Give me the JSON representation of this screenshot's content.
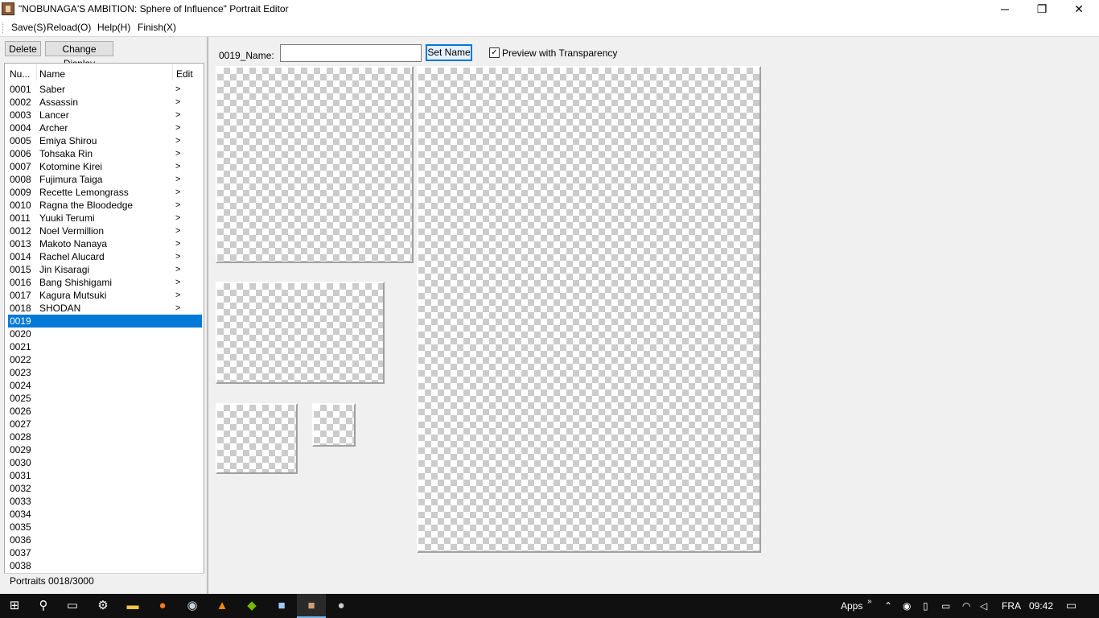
{
  "window": {
    "title": "\"NOBUNAGA'S AMBITION: Sphere of Influence\" Portrait Editor",
    "minimize": "─",
    "maximize": "❐",
    "close": "✕"
  },
  "menu": [
    {
      "label": "Save(S)"
    },
    {
      "label": "Reload(O)"
    },
    {
      "label": "Help(H)"
    },
    {
      "label": "Finish(X)"
    }
  ],
  "toolbar": {
    "delete_label": "Delete",
    "change_display_label": "Change Display"
  },
  "list": {
    "headers": {
      "num": "Nu...",
      "name": "Name",
      "edit": "Edit"
    },
    "rows": [
      {
        "num": "0001",
        "name": "Saber",
        "edit": ">"
      },
      {
        "num": "0002",
        "name": "Assassin",
        "edit": ">"
      },
      {
        "num": "0003",
        "name": "Lancer",
        "edit": ">"
      },
      {
        "num": "0004",
        "name": "Archer",
        "edit": ">"
      },
      {
        "num": "0005",
        "name": "Emiya Shirou",
        "edit": ">"
      },
      {
        "num": "0006",
        "name": "Tohsaka Rin",
        "edit": ">"
      },
      {
        "num": "0007",
        "name": "Kotomine Kirei",
        "edit": ">"
      },
      {
        "num": "0008",
        "name": "Fujimura Taiga",
        "edit": ">"
      },
      {
        "num": "0009",
        "name": "Recette Lemongrass",
        "edit": ">"
      },
      {
        "num": "0010",
        "name": "Ragna the Bloodedge",
        "edit": ">"
      },
      {
        "num": "0011",
        "name": "Yuuki Terumi",
        "edit": ">"
      },
      {
        "num": "0012",
        "name": "Noel Vermillion",
        "edit": ">"
      },
      {
        "num": "0013",
        "name": "Makoto Nanaya",
        "edit": ">"
      },
      {
        "num": "0014",
        "name": "Rachel Alucard",
        "edit": ">"
      },
      {
        "num": "0015",
        "name": "Jin Kisaragi",
        "edit": ">"
      },
      {
        "num": "0016",
        "name": "Bang Shishigami",
        "edit": ">"
      },
      {
        "num": "0017",
        "name": "Kagura Mutsuki",
        "edit": ">"
      },
      {
        "num": "0018",
        "name": "SHODAN",
        "edit": ">"
      },
      {
        "num": "0019",
        "name": "",
        "edit": "",
        "selected": true
      },
      {
        "num": "0020",
        "name": "",
        "edit": ""
      },
      {
        "num": "0021",
        "name": "",
        "edit": ""
      },
      {
        "num": "0022",
        "name": "",
        "edit": ""
      },
      {
        "num": "0023",
        "name": "",
        "edit": ""
      },
      {
        "num": "0024",
        "name": "",
        "edit": ""
      },
      {
        "num": "0025",
        "name": "",
        "edit": ""
      },
      {
        "num": "0026",
        "name": "",
        "edit": ""
      },
      {
        "num": "0027",
        "name": "",
        "edit": ""
      },
      {
        "num": "0028",
        "name": "",
        "edit": ""
      },
      {
        "num": "0029",
        "name": "",
        "edit": ""
      },
      {
        "num": "0030",
        "name": "",
        "edit": ""
      },
      {
        "num": "0031",
        "name": "",
        "edit": ""
      },
      {
        "num": "0032",
        "name": "",
        "edit": ""
      },
      {
        "num": "0033",
        "name": "",
        "edit": ""
      },
      {
        "num": "0034",
        "name": "",
        "edit": ""
      },
      {
        "num": "0035",
        "name": "",
        "edit": ""
      },
      {
        "num": "0036",
        "name": "",
        "edit": ""
      },
      {
        "num": "0037",
        "name": "",
        "edit": ""
      },
      {
        "num": "0038",
        "name": "",
        "edit": ""
      }
    ]
  },
  "status": {
    "text": "Portraits 0018/3000"
  },
  "editor": {
    "name_label": "0019_Name:",
    "name_value": "",
    "set_name_label": "Set Name",
    "preview_label": "Preview with Transparency",
    "preview_checked": true
  },
  "taskbar": {
    "apps_label": "Apps",
    "lang": "FRA",
    "time": "09:42",
    "icons": [
      "windows-icon",
      "search-icon",
      "task-view-icon",
      "settings-icon",
      "file-explorer-icon",
      "firefox-icon",
      "steam-icon",
      "vlc-icon",
      "nvidia-icon",
      "app-icon",
      "portrait-editor-icon",
      "gimp-icon"
    ]
  },
  "colors": {
    "selection": "#0078d7",
    "accent": "#0078d7",
    "taskbar": "#101010"
  }
}
